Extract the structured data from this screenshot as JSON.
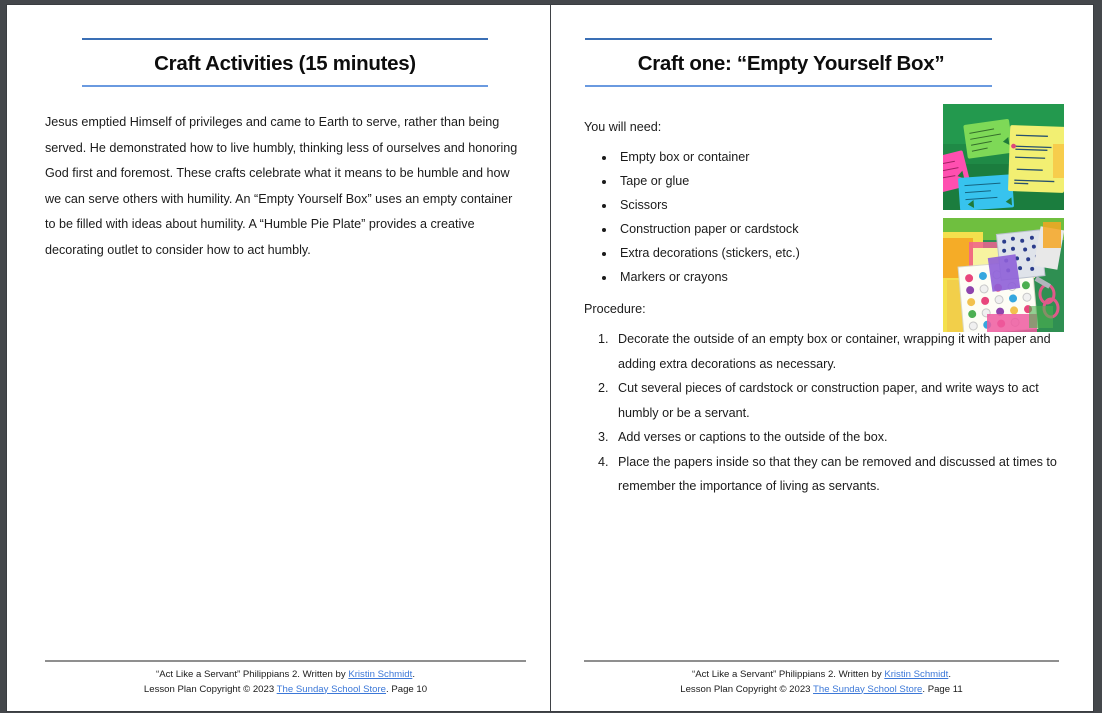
{
  "document": {
    "background_color": "#44474b",
    "page_color": "#ffffff",
    "rule_color": "#3a6fb5",
    "rule_color_light": "#6a9ae0",
    "link_color": "#3c78d8"
  },
  "left_page": {
    "title": "Craft Activities (15 minutes)",
    "paragraph": "Jesus emptied Himself of privileges and came to Earth to serve, rather than being served. He demonstrated how to live humbly, thinking less of ourselves and honoring God first and foremost. These crafts celebrate what it means to be humble and how we can serve others with humility. An “Empty Yourself Box” uses an empty container to be filled with ideas about humility. A “Humble Pie Plate” provides a creative decorating outlet to consider how to act humbly.",
    "footer": {
      "line1_pre": "“Act Like a Servant” Philippians 2.  Written by ",
      "line1_link": "Kristin Schmidt",
      "line1_post": ".",
      "line2_pre": "Lesson Plan Copyright © 2023 ",
      "line2_link": "The Sunday School Store",
      "line2_post": ". Page 10"
    }
  },
  "right_page": {
    "title": "Craft one: “Empty Yourself Box”",
    "materials_label": "You will need:",
    "materials": [
      "Empty box or container",
      "Tape or glue",
      "Scissors",
      "Construction paper or cardstock",
      "Extra decorations (stickers, etc.)",
      "Markers or crayons"
    ],
    "procedure_label": "Procedure:",
    "procedure": [
      "Decorate the outside of an empty box or container, wrapping it with paper and adding extra decorations as necessary.",
      "Cut several pieces of cardstock or construction paper, and write ways to act humbly or be a servant.",
      "Add verses or captions to the outside of the box.",
      "Place the papers inside so that they can be removed and discussed at times to remember the importance of living as servants."
    ],
    "photos": [
      {
        "name": "photo-empty-yourself-box-cards",
        "alt": "Colorful handwritten paper cards on a green cloth"
      },
      {
        "name": "photo-craft-supplies",
        "alt": "Sticker sheets, colored paper, decorated box and scissors"
      }
    ],
    "footer": {
      "line1_pre": "“Act Like a Servant” Philippians 2.  Written by ",
      "line1_link": "Kristin Schmidt",
      "line1_post": ".",
      "line2_pre": "Lesson Plan Copyright © 2023 ",
      "line2_link": "The Sunday School Store",
      "line2_post": ". Page 11"
    }
  }
}
